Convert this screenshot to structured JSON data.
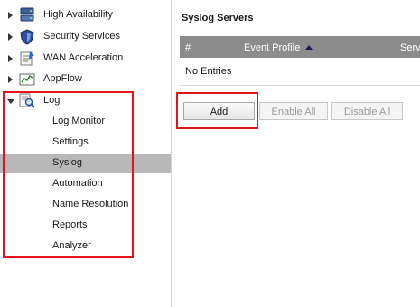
{
  "sidebar": {
    "items": [
      {
        "label": "High Availability",
        "icon": "server-icon"
      },
      {
        "label": "Security Services",
        "icon": "shield-icon"
      },
      {
        "label": "WAN Acceleration",
        "icon": "wan-acceleration-icon"
      },
      {
        "label": "AppFlow",
        "icon": "appflow-chart-icon"
      },
      {
        "label": "Log",
        "icon": "log-magnifier-icon"
      }
    ],
    "log_subitems": [
      {
        "label": "Log Monitor"
      },
      {
        "label": "Settings"
      },
      {
        "label": "Syslog"
      },
      {
        "label": "Automation"
      },
      {
        "label": "Name Resolution"
      },
      {
        "label": "Reports"
      },
      {
        "label": "Analyzer"
      }
    ],
    "selected": "Syslog"
  },
  "main": {
    "title": "Syslog Servers",
    "table": {
      "columns": [
        "#",
        "Event Profile",
        "Serve"
      ],
      "sort_column": "Event Profile",
      "sort_direction": "ascending",
      "empty_text": "No Entries"
    },
    "buttons": {
      "add": "Add",
      "enable_all": "Enable All",
      "disable_all": "Disable All"
    }
  },
  "colors": {
    "highlight": "#e0141b",
    "header_bg": "#8c8c8c",
    "selected_bg": "#b8b8b8"
  }
}
